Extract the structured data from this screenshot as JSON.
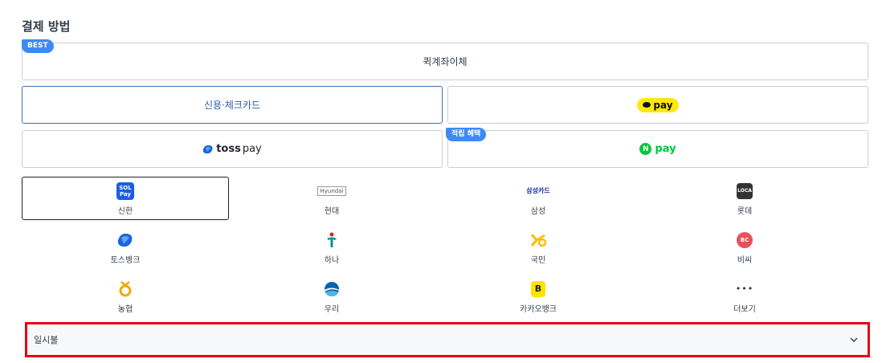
{
  "section_title": "결제 방법",
  "options": {
    "quick_transfer": {
      "label": "퀵계좌이체",
      "badge": "BEST"
    },
    "card": {
      "label": "신용·체크카드"
    },
    "kakaopay": {
      "label": "pay"
    },
    "tosspay": {
      "brand": "toss",
      "suffix": "pay"
    },
    "naverpay": {
      "n": "N",
      "label": "pay",
      "badge": "적립 혜택"
    }
  },
  "banks": [
    {
      "label": "신한",
      "logo_text": "SOL Pay",
      "icon": "shinhan-sol-pay-icon"
    },
    {
      "label": "현대",
      "logo_text": "Hyundai",
      "icon": "hyundai-card-icon"
    },
    {
      "label": "삼성",
      "logo_text": "삼성카드",
      "icon": "samsung-card-icon"
    },
    {
      "label": "롯데",
      "logo_text": "LOCA",
      "icon": "lotte-loca-icon"
    },
    {
      "label": "토스뱅크",
      "icon": "tossbank-icon"
    },
    {
      "label": "하나",
      "icon": "hana-icon"
    },
    {
      "label": "국민",
      "icon": "kb-icon"
    },
    {
      "label": "비씨",
      "logo_text": "BC",
      "icon": "bc-icon"
    },
    {
      "label": "농협",
      "icon": "nh-icon"
    },
    {
      "label": "우리",
      "icon": "woori-icon"
    },
    {
      "label": "카카오뱅크",
      "logo_text": "B",
      "icon": "kakaobank-icon"
    },
    {
      "label": "더보기",
      "logo_text": "•••",
      "icon": "more-icon"
    }
  ],
  "installment": {
    "value": "일시불"
  },
  "colors": {
    "accent": "#3d8af7",
    "selected_border": "#3f6fb5",
    "highlight": "#e60012",
    "kakao_yellow": "#ffe812",
    "naver_green": "#00c73c"
  }
}
